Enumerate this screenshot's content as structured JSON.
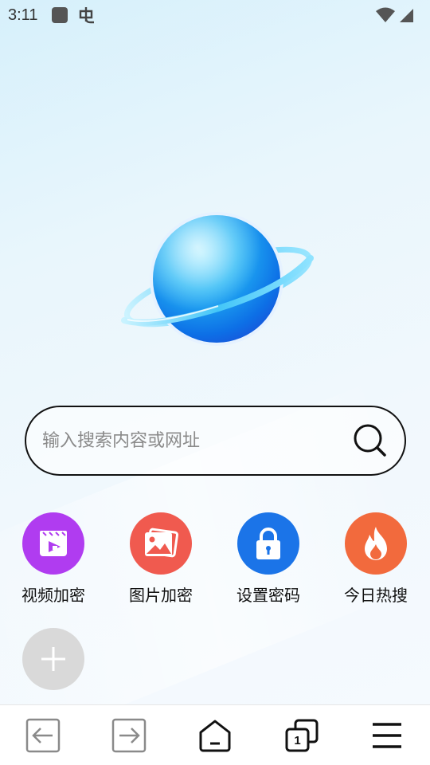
{
  "status_bar": {
    "time": "3:11",
    "icons": [
      "app-square-icon",
      "bug-icon",
      "wifi-icon",
      "signal-icon"
    ]
  },
  "search": {
    "placeholder": "输入搜索内容或网址",
    "icon": "search-icon"
  },
  "shortcuts": [
    {
      "label": "视频加密",
      "icon": "video-lock-icon",
      "color": "#b03cf0"
    },
    {
      "label": "图片加密",
      "icon": "image-icon",
      "color": "#f05a4f"
    },
    {
      "label": "设置密码",
      "icon": "lock-icon",
      "color": "#1b74e8"
    },
    {
      "label": "今日热搜",
      "icon": "flame-icon",
      "color": "#f26a3d"
    }
  ],
  "add_shortcut": {
    "icon": "plus-icon"
  },
  "bottom_nav": {
    "tab_count": "1",
    "items": [
      "back-icon",
      "forward-icon",
      "home-icon",
      "tabs-icon",
      "menu-icon"
    ]
  }
}
